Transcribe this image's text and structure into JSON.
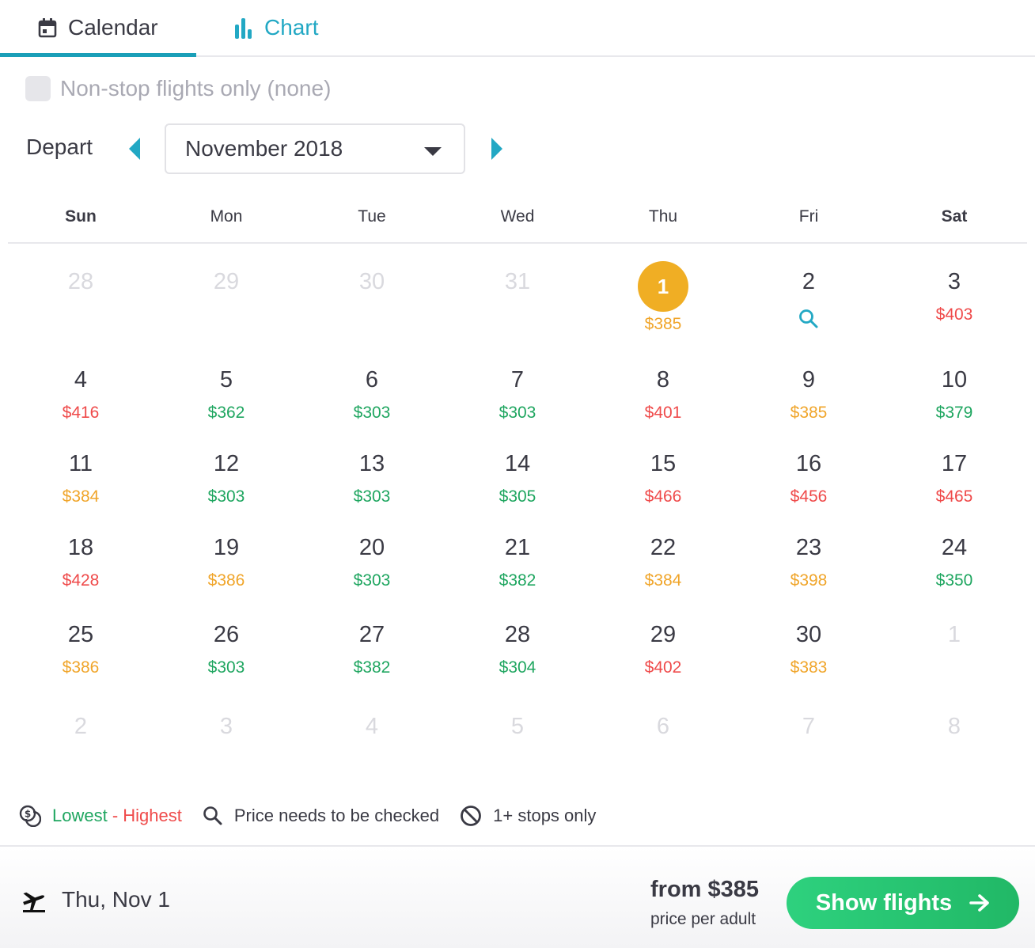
{
  "tabs": [
    {
      "label": "Calendar",
      "icon": "calendar-icon",
      "active": true
    },
    {
      "label": "Chart",
      "icon": "bar-chart-icon",
      "active": false
    }
  ],
  "filters": {
    "nonstop_label": "Non-stop flights only (none)",
    "nonstop_checked": false
  },
  "depart": {
    "label": "Depart",
    "month": "November 2018"
  },
  "weekdays": [
    "Sun",
    "Mon",
    "Tue",
    "Wed",
    "Thu",
    "Fri",
    "Sat"
  ],
  "weeks": [
    [
      {
        "day": "28",
        "muted": true
      },
      {
        "day": "29",
        "muted": true
      },
      {
        "day": "30",
        "muted": true
      },
      {
        "day": "31",
        "muted": true
      },
      {
        "day": "1",
        "price": "$385",
        "level": "orange",
        "selected": true
      },
      {
        "day": "2",
        "icon": "search-icon"
      },
      {
        "day": "3",
        "price": "$403",
        "level": "red"
      }
    ],
    [
      {
        "day": "4",
        "price": "$416",
        "level": "red"
      },
      {
        "day": "5",
        "price": "$362",
        "level": "green"
      },
      {
        "day": "6",
        "price": "$303",
        "level": "green"
      },
      {
        "day": "7",
        "price": "$303",
        "level": "green"
      },
      {
        "day": "8",
        "price": "$401",
        "level": "red"
      },
      {
        "day": "9",
        "price": "$385",
        "level": "orange"
      },
      {
        "day": "10",
        "price": "$379",
        "level": "green"
      }
    ],
    [
      {
        "day": "11",
        "price": "$384",
        "level": "orange"
      },
      {
        "day": "12",
        "price": "$303",
        "level": "green"
      },
      {
        "day": "13",
        "price": "$303",
        "level": "green"
      },
      {
        "day": "14",
        "price": "$305",
        "level": "green"
      },
      {
        "day": "15",
        "price": "$466",
        "level": "red"
      },
      {
        "day": "16",
        "price": "$456",
        "level": "red"
      },
      {
        "day": "17",
        "price": "$465",
        "level": "red"
      }
    ],
    [
      {
        "day": "18",
        "price": "$428",
        "level": "red"
      },
      {
        "day": "19",
        "price": "$386",
        "level": "orange"
      },
      {
        "day": "20",
        "price": "$303",
        "level": "green"
      },
      {
        "day": "21",
        "price": "$382",
        "level": "green"
      },
      {
        "day": "22",
        "price": "$384",
        "level": "orange"
      },
      {
        "day": "23",
        "price": "$398",
        "level": "orange"
      },
      {
        "day": "24",
        "price": "$350",
        "level": "green"
      }
    ],
    [
      {
        "day": "25",
        "price": "$386",
        "level": "orange"
      },
      {
        "day": "26",
        "price": "$303",
        "level": "green"
      },
      {
        "day": "27",
        "price": "$382",
        "level": "green"
      },
      {
        "day": "28",
        "price": "$304",
        "level": "green"
      },
      {
        "day": "29",
        "price": "$402",
        "level": "red"
      },
      {
        "day": "30",
        "price": "$383",
        "level": "orange"
      },
      {
        "day": "1",
        "muted": true
      }
    ],
    [
      {
        "day": "2",
        "muted": true
      },
      {
        "day": "3",
        "muted": true
      },
      {
        "day": "4",
        "muted": true
      },
      {
        "day": "5",
        "muted": true
      },
      {
        "day": "6",
        "muted": true
      },
      {
        "day": "7",
        "muted": true
      },
      {
        "day": "8",
        "muted": true
      }
    ]
  ],
  "legend": {
    "lowest": "Lowest",
    "separator": " - ",
    "highest": "Highest",
    "check_label": "Price needs to be checked",
    "stops_label": "1+ stops only"
  },
  "footer": {
    "date": "Thu, Nov 1",
    "from_price": "from $385",
    "per_adult": "price per adult",
    "button_label": "Show flights"
  },
  "colors": {
    "accent": "#1a9fb8",
    "selected": "#f0ae24",
    "low": "#1fa660",
    "mid": "#f0a52a",
    "high": "#ef4a4a",
    "button": "#21b866"
  }
}
